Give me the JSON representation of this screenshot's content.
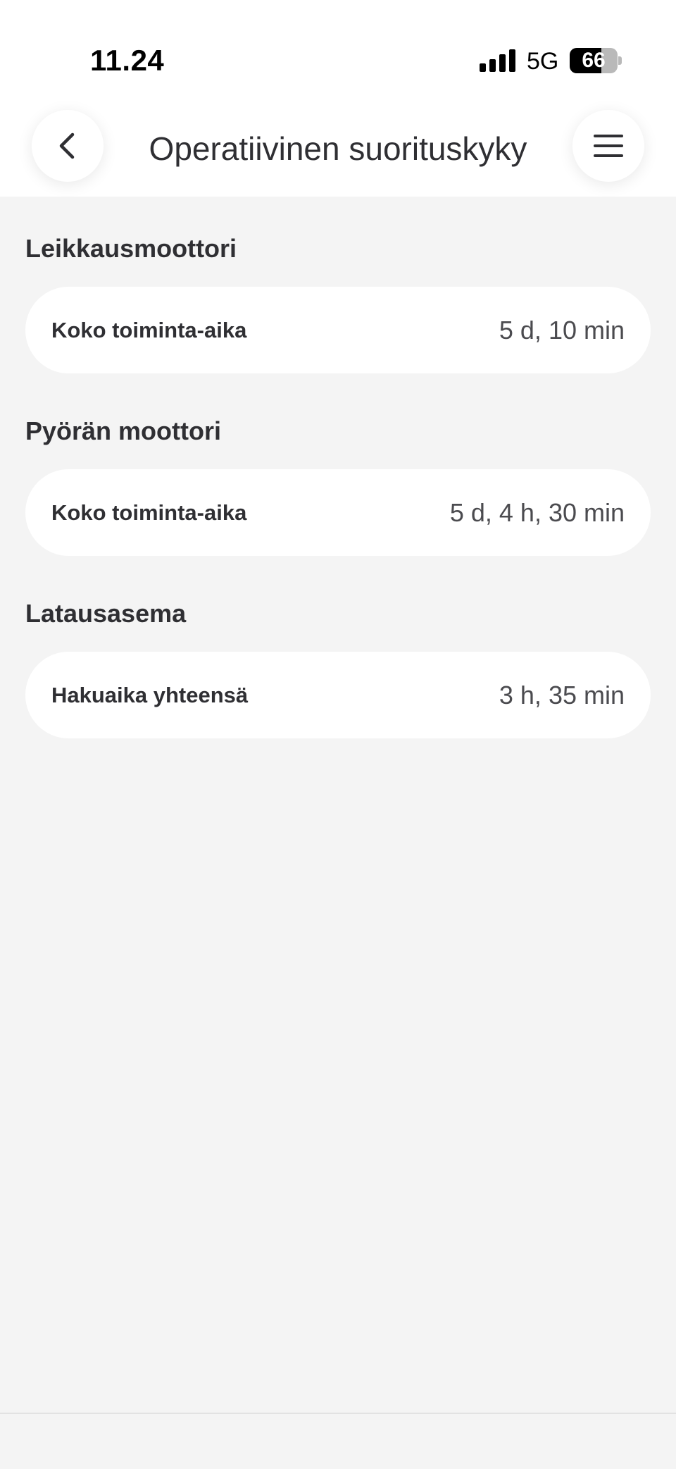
{
  "status_bar": {
    "time": "11.24",
    "network": "5G",
    "battery": "66",
    "battery_level": 0.66
  },
  "header": {
    "title": "Operatiivinen suorituskyky",
    "back_icon": "chevron-left-icon",
    "menu_icon": "hamburger-menu-icon"
  },
  "sections": [
    {
      "title": "Leikkausmoottori",
      "rows": [
        {
          "label": "Koko toiminta-aika",
          "value": "5 d, 10 min"
        }
      ]
    },
    {
      "title": "Pyörän moottori",
      "rows": [
        {
          "label": "Koko toiminta-aika",
          "value": "5 d, 4 h, 30 min"
        }
      ]
    },
    {
      "title": "Latausasema",
      "rows": [
        {
          "label": "Hakuaika yhteensä",
          "value": "3 h, 35 min"
        }
      ]
    }
  ],
  "colors": {
    "background": "#f4f4f4",
    "card": "#ffffff",
    "text": "#2f2f33",
    "value_text": "#4b4b4f"
  }
}
